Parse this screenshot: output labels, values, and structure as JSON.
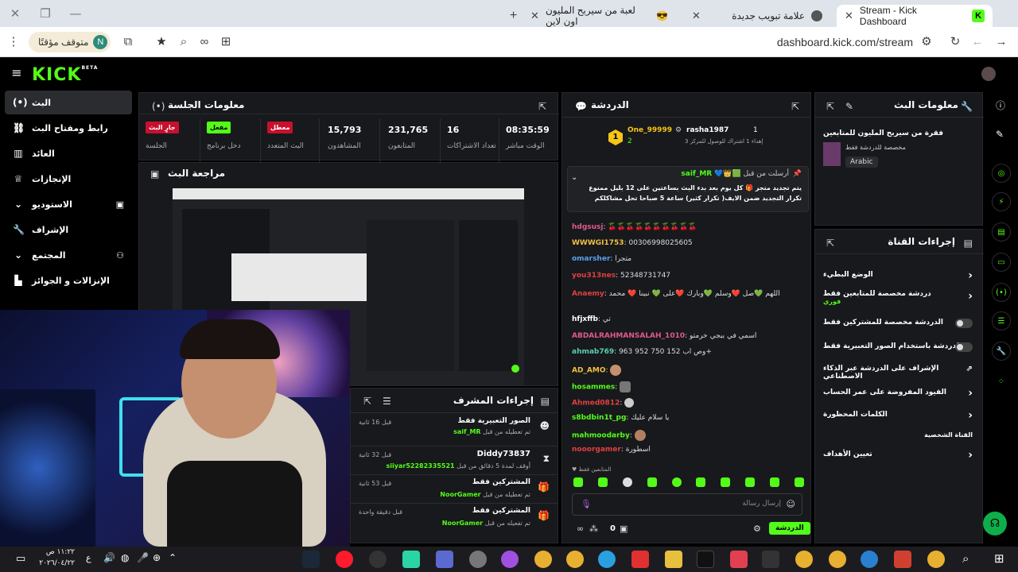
{
  "browser": {
    "tabs": [
      {
        "title": "Stream - Kick Dashboard",
        "active": true
      },
      {
        "title": "علامة تبويب جديدة",
        "active": false
      },
      {
        "title": "لعبة من سيربح المليون اون لاين",
        "active": false
      }
    ],
    "url": "dashboard.kick.com/stream",
    "profile_label": "متوقف مؤقتًا",
    "profile_initial": "N"
  },
  "kick": {
    "logo": "KICK",
    "logo_beta": "BETA"
  },
  "nav": {
    "items": [
      {
        "label": "البث",
        "active": true
      },
      {
        "label": "رابط ومفتاح البث"
      },
      {
        "label": "العائد"
      },
      {
        "label": "الإنجازات"
      },
      {
        "label": "الاستوديو"
      },
      {
        "label": "الإشراف"
      },
      {
        "label": "المجتمع"
      },
      {
        "label": "الإنزالات و الجوائز"
      }
    ]
  },
  "session": {
    "title": "معلومات الجلسة",
    "stats": [
      {
        "value": "08:35:59",
        "label": "الوقت مباشر"
      },
      {
        "value": "16",
        "label": "تعداد الاشتراكات"
      },
      {
        "value": "231,765",
        "label": "المتابعون"
      },
      {
        "value": "15,793",
        "label": "المشاهدون"
      },
      {
        "badge": "معطل",
        "label": "البث المتعدد"
      },
      {
        "badge": "مفعل",
        "label": "دخل برنامج"
      },
      {
        "badge": "جارٍ البث",
        "label": "الجلسة"
      }
    ]
  },
  "review": {
    "title": "مراجعة البث"
  },
  "modactions": {
    "title": "إجراءات المشرف",
    "items": [
      {
        "title": "الصور التعبيرية فقط",
        "desc": "تم تعطيله من قبل",
        "user": "saif_MR",
        "time": "قبل 16 ثانية"
      },
      {
        "title": "Diddy73837",
        "desc": "أوقف لمدة 5 دقائق من قبل",
        "user": "siiyar52282335521",
        "time": "قبل 32 ثانية"
      },
      {
        "title": "المشتركين فقط",
        "desc": "تم تعطيله من قبل",
        "user": "NoorGamer",
        "time": "قبل 53 ثانية"
      },
      {
        "title": "المشتركين فقط",
        "desc": "تم تفعيله من قبل",
        "user": "NoorGamer",
        "time": "قبل دقيقة واحدة"
      }
    ]
  },
  "chat": {
    "title": "الدردشة",
    "top_gifters": [
      {
        "name": "One_99999",
        "count": "2"
      },
      {
        "name": "rasha1987",
        "count": "1",
        "note": "إهداء 1 اشتراك للوصول للمركز 3"
      }
    ],
    "pinned": {
      "author": "saif_MR",
      "pinned_by": "أرسلت من قبل",
      "text": "يتم تجديد متجر 🎁 كل يوم بعد بدء البث بساعتين على 12 بليل ممنوع تكرار التجديد ضمن الايف( تكرار كثير) ساعة 5 صباحا تحل مشاكلكم بالمتجر ،فيديو كيف تربح"
    },
    "messages": [
      {
        "user": "hdgsusj",
        "text": "🍒🍒🍒🍒🍒🍒🍒🍒🍒🍒",
        "color": "#e05a8a"
      },
      {
        "user": "WWWGI1753",
        "text": "00306998025605",
        "color": "#f0c040"
      },
      {
        "user": "omarsher",
        "text": "متجرا",
        "color": "#5aa0f0"
      },
      {
        "user": "you313nes",
        "text": "52348731747",
        "color": "#e04040"
      },
      {
        "user": "Anaemy",
        "text": "اللهم 💚صل ❤️وسلم 💚وبارك ❤️على 💚 نبينا ❤️ محمد",
        "color": "#e04040"
      },
      {
        "user": "hfjxffb",
        "text": "تي",
        "color": "#ffffff"
      },
      {
        "user": "ABDALRAHMANSALAH_1010",
        "text": "اسمي في ببجي خرمتو",
        "color": "#e05a8a"
      },
      {
        "user": "ahmab769",
        "text": "وص اب 152 750 952 963+",
        "color": "#5ad0b0"
      },
      {
        "user": "AD_AMO",
        "text": "",
        "color": "#f0c040"
      },
      {
        "user": "hosammes",
        "text": "",
        "color": "#53fc18"
      },
      {
        "user": "Ahmed0812",
        "text": "",
        "color": "#e04040"
      },
      {
        "user": "s8bdbin1t_pg",
        "text": "يا سلام عليك",
        "color": "#53fc18"
      },
      {
        "user": "mahmoodarby",
        "text": "",
        "color": "#53fc18"
      },
      {
        "user": "nooorgamer",
        "text": "اسطورة",
        "color": "#e04040"
      }
    ],
    "emote_label": "المتابعين فقط",
    "input_placeholder": "إرسال رسالة",
    "send_label": "الدردشة",
    "count": "0"
  },
  "streaminfo": {
    "title": "معلومات البث",
    "stream_title": "فقرة من سيربح المليون للمتابعين",
    "desc": "مخصصة للدردشة فقط",
    "language": "Arabic"
  },
  "channelactions": {
    "title": "إجراءات القناة",
    "items": [
      {
        "label": "الوضع البطيء",
        "kind": "arrow"
      },
      {
        "label": "دردشة مخصصة للمتابعين فقط",
        "sub": "فوري",
        "kind": "arrow"
      },
      {
        "label": "الدردشة مخصصة للمشتركين فقط",
        "kind": "toggle"
      },
      {
        "label": "الدردشة باستخدام الصور التعبيرية فقط",
        "kind": "toggle"
      },
      {
        "label": "الإشراف على الدردشة عبر الذكاء الاصطناعي",
        "kind": "link"
      },
      {
        "label": "القيود المفروضة على عمر الحساب",
        "kind": "arrow"
      },
      {
        "label": "الكلمات المحظورة",
        "kind": "arrow"
      },
      {
        "label": "القناة الشخصية",
        "kind": "heading"
      },
      {
        "label": "تعيين الأهداف",
        "kind": "arrow"
      }
    ]
  },
  "taskbar": {
    "time": "١١:٢٢ ص",
    "date": "٢٠٢٦/٠٤/٢٢",
    "lang": "ع"
  }
}
